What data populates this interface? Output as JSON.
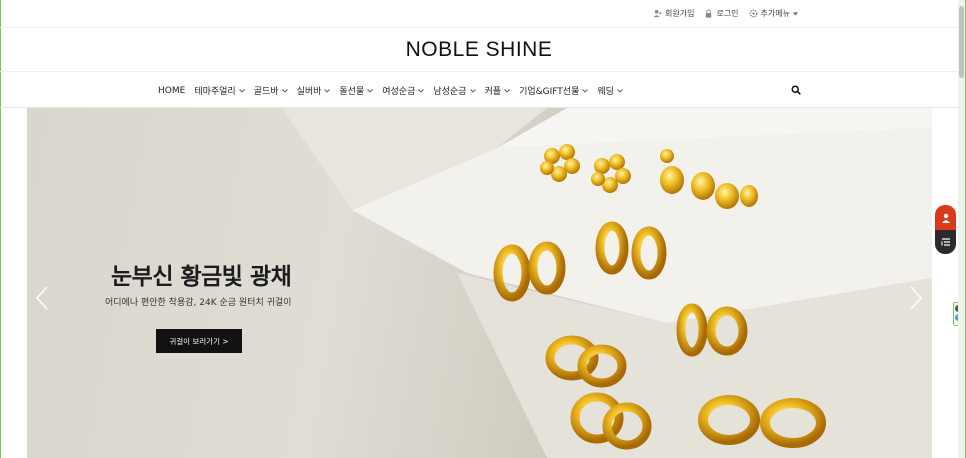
{
  "topbar": {
    "links": [
      {
        "label": "회원가입",
        "icon": "user-plus-icon"
      },
      {
        "label": "로그인",
        "icon": "lock-icon"
      },
      {
        "label": "추가메뉴",
        "icon": "gear-icon"
      }
    ]
  },
  "header": {
    "logo": "NOBLE SHINE"
  },
  "nav": {
    "items": [
      {
        "label": "HOME",
        "has_dropdown": false
      },
      {
        "label": "테마주얼리",
        "has_dropdown": true
      },
      {
        "label": "골드바",
        "has_dropdown": true
      },
      {
        "label": "실버바",
        "has_dropdown": true
      },
      {
        "label": "돌선물",
        "has_dropdown": true
      },
      {
        "label": "여성순금",
        "has_dropdown": true
      },
      {
        "label": "남성순금",
        "has_dropdown": true
      },
      {
        "label": "커플",
        "has_dropdown": true
      },
      {
        "label": "기업&GIFT선물",
        "has_dropdown": true
      },
      {
        "label": "웨딩",
        "has_dropdown": true
      }
    ],
    "search_icon": "search-icon"
  },
  "hero": {
    "title": "눈부신 황금빛 광채",
    "subtitle": "어디에나 편안한 착용감, 24K 순금 원터치 귀걸이",
    "button_label": "귀걸이 보러가기 >"
  },
  "colors": {
    "accent_red": "#d93a1b",
    "dark": "#2b2b2b",
    "gold": "#e0a818",
    "frame_green": "#7bc74d"
  }
}
